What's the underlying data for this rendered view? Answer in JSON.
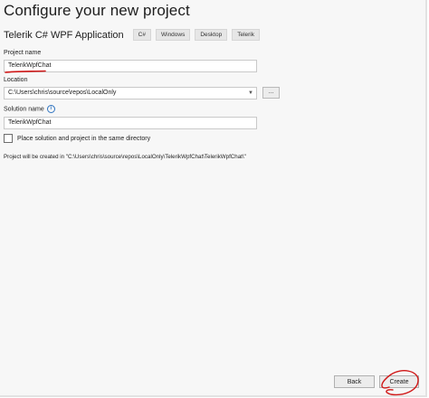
{
  "window": {
    "title": "Configure your new project"
  },
  "template": {
    "name": "Telerik C# WPF Application",
    "tags": [
      "C#",
      "Windows",
      "Desktop",
      "Telerik"
    ]
  },
  "project_name": {
    "label": "Project name",
    "value": "TelerikWpfChat"
  },
  "location": {
    "label": "Location",
    "value": "C:\\Users\\chris\\source\\repos\\LocalOnly",
    "browse_label": "..."
  },
  "solution_name": {
    "label": "Solution name",
    "value": "TelerikWpfChat",
    "info_glyph": "i"
  },
  "same_directory": {
    "label": "Place solution and project in the same directory",
    "checked": false
  },
  "created_path_text": "Project will be created in \"C:\\Users\\chris\\source\\repos\\LocalOnly\\TelerikWpfChat\\TelerikWpfChat\\\"",
  "footer": {
    "back_label": "Back",
    "create_label": "Create"
  },
  "colors": {
    "annotation_ink": "#d01818",
    "info_accent": "#2f74c0",
    "dialog_background": "#f7f7f7"
  }
}
